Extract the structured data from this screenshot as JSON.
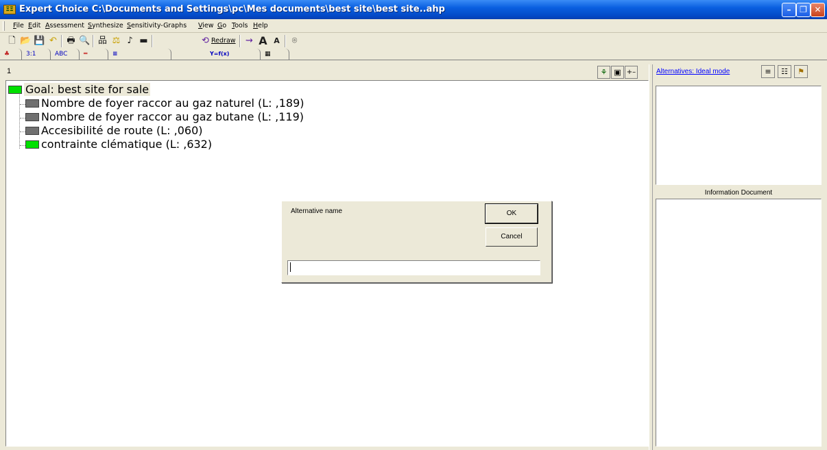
{
  "window": {
    "app_icon_text": "ΞΞ",
    "title": "Expert Choice     C:\\Documents and Settings\\pc\\Mes documents\\best site\\best site..ahp",
    "minimize": "–",
    "maximize": "❐",
    "close": "✕"
  },
  "menu": [
    "File",
    "Edit",
    "Assessment",
    "Synthesize",
    "Sensitivity-Graphs",
    "View",
    "Go",
    "Tools",
    "Help"
  ],
  "toolbar": {
    "redraw_label": "Redraw",
    "icons": [
      "new-file-icon",
      "open-folder-icon",
      "save-icon",
      "undo-icon",
      "print-icon",
      "print-preview-icon",
      "hierarchy-icon",
      "balance-icon",
      "music-note-icon",
      "rectangle-icon",
      "redraw-icon",
      "pointer-icon",
      "font-larger-icon",
      "font-smaller-icon",
      "help-icon"
    ]
  },
  "tabs": [
    {
      "label": "",
      "icon": "people-icon"
    },
    {
      "label": "3:1"
    },
    {
      "label": "ABC"
    },
    {
      "label": "═"
    },
    {
      "label": "≡"
    },
    {
      "label": "Y=f(x)"
    },
    {
      "label": "▦"
    }
  ],
  "tree": {
    "header_number": "1",
    "goal": "Goal: best site for sale",
    "children": [
      {
        "label": "Nombre de foyer raccor au gaz naturel (L: ,189)",
        "color": "#707070"
      },
      {
        "label": "Nombre de foyer raccor au gaz butane (L: ,119)",
        "color": "#707070"
      },
      {
        "label": "Accesibilité de route (L: ,060)",
        "color": "#707070"
      },
      {
        "label": "contrainte clématique (L: ,632)",
        "color": "#00e000"
      }
    ]
  },
  "dialog": {
    "label": "Alternative name",
    "ok": "OK",
    "cancel": "Cancel",
    "input_value": ""
  },
  "right_panel": {
    "alternatives_link": "Alternatives: Ideal mode",
    "info_label": "Information Document"
  }
}
